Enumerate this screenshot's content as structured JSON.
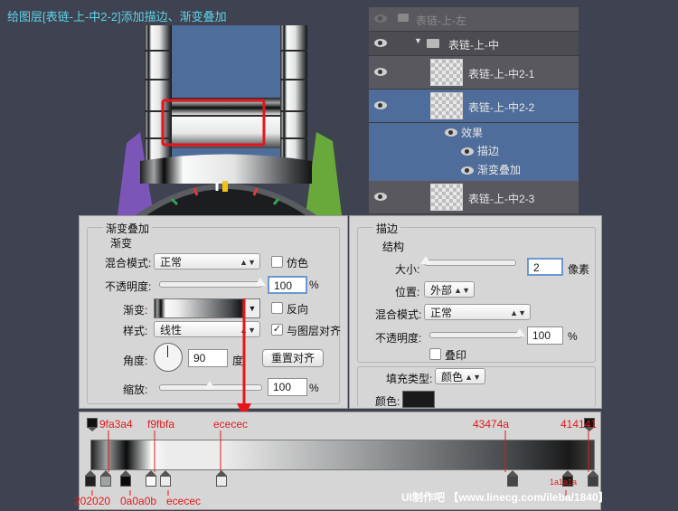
{
  "title": "给图层[表链-上-中2-2]添加描边、渐变叠加",
  "layers_panel": {
    "rows": [
      {
        "name": "表链-上-左",
        "type": "group"
      },
      {
        "name": "表链-上-中",
        "type": "group"
      },
      {
        "name": "表链-上-中2-1",
        "type": "layer"
      },
      {
        "name": "表链-上-中2-2",
        "type": "layer",
        "selected": true
      },
      {
        "name": "效果",
        "type": "effects"
      },
      {
        "name": "描边",
        "type": "effect"
      },
      {
        "name": "渐变叠加",
        "type": "effect"
      },
      {
        "name": "表链-上-中2-3",
        "type": "layer"
      }
    ],
    "selected_color": "#4f6d9a"
  },
  "gradient_overlay": {
    "title": "渐变叠加",
    "section": "渐变",
    "blend_mode_label": "混合模式:",
    "blend_mode": "正常",
    "dither_label": "仿色",
    "dither_checked": false,
    "opacity_label": "不透明度:",
    "opacity": "100",
    "opacity_unit": "%",
    "opacity_level": 1.0,
    "gradient_label": "渐变:",
    "reverse_label": "反向",
    "reverse_checked": false,
    "style_label": "样式:",
    "style": "线性",
    "align_label": "与图层对齐",
    "align_checked": true,
    "align_mark": "✓",
    "angle_label": "角度:",
    "angle": "90",
    "angle_unit": "度",
    "reset_label": "重置对齐",
    "scale_label": "缩放:",
    "scale": "100",
    "scale_unit": "%",
    "scale_level": 0.5
  },
  "stroke": {
    "title": "描边",
    "section": "结构",
    "size_label": "大小:",
    "size": "2",
    "size_unit": "像素",
    "position_label": "位置:",
    "position": "外部",
    "blend_mode_label": "混合模式:",
    "blend_mode": "正常",
    "opacity_label": "不透明度:",
    "opacity": "100",
    "opacity_unit": "%",
    "opacity_level": 1.0,
    "overprint_label": "叠印",
    "overprint_checked": false,
    "fill_type_label": "填充类型:",
    "fill_type": "颜色",
    "color_label": "颜色:",
    "color": "#1a1a1a"
  },
  "gradient_editor": {
    "top_labels": [
      "9fa3a4",
      "f9fbfa",
      "ececec",
      "43474a",
      "414141"
    ],
    "bottom_labels": [
      "202020",
      "0a0a0b",
      "ececec",
      "1a1a1a"
    ],
    "stops": [
      {
        "color": "#202020",
        "location": 0.0
      },
      {
        "color": "#9fa3a4",
        "location": 0.03
      },
      {
        "color": "#0a0a0b",
        "location": 0.07
      },
      {
        "color": "#f9fbfa",
        "location": 0.12
      },
      {
        "color": "#ececec",
        "location": 0.15
      },
      {
        "color": "#ececec",
        "location": 0.26
      },
      {
        "color": "#43474a",
        "location": 0.84
      },
      {
        "color": "#1a1a1a",
        "location": 0.95
      },
      {
        "color": "#414141",
        "location": 1.0
      }
    ],
    "annotation_color": "#e01b1b"
  },
  "watermark": "UI制作吧 【www.linecg.com/ileba/1840】"
}
